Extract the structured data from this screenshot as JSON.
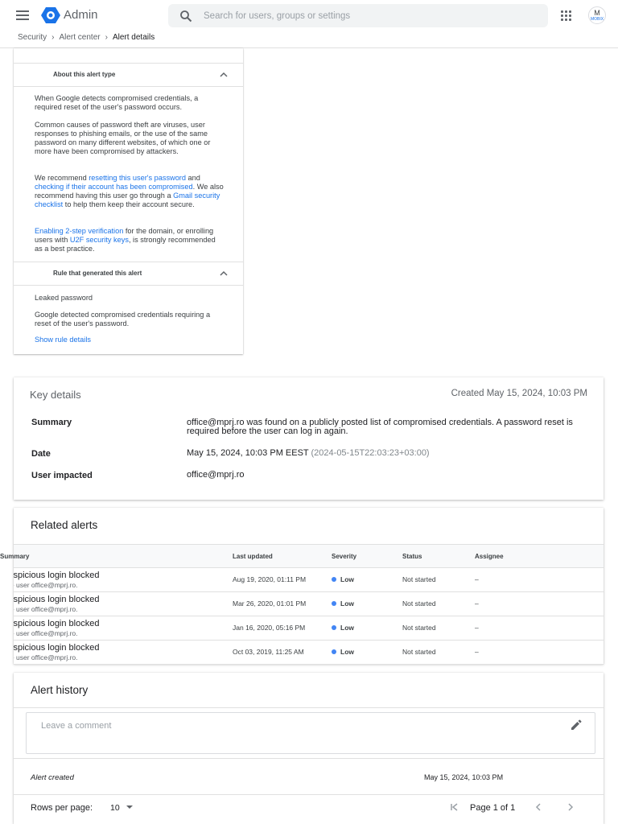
{
  "header": {
    "brand": "Admin",
    "search_placeholder": "Search for users, groups or settings",
    "avatar_text": "M",
    "avatar_small": "MOBIX"
  },
  "breadcrumb": [
    "Security",
    "Alert center",
    "Alert details"
  ],
  "about_panel": {
    "title": "About this alert type",
    "p1": "When Google detects compromised credentials, a required reset of the user's password occurs.",
    "p2": "Common causes of password theft are viruses, user responses to phishing emails, or the use of the same password on many different websites, of which one or more have been compromised by attackers.",
    "p3_a": "We recommend ",
    "p3_link1": "resetting this user's password",
    "p3_b": " and ",
    "p3_link2": "checking if their account has been compromised",
    "p3_c": ". We also recommend having this user go through a ",
    "p3_link3": "Gmail security checklist",
    "p3_d": " to help them keep their account secure.",
    "p4_link1": "Enabling 2-step verification",
    "p4_a": " for the domain, or enrolling users with ",
    "p4_link2": "U2F security keys",
    "p4_b": ", is strongly recommended as a best practice."
  },
  "rule_panel": {
    "title": "Rule that generated this alert",
    "rule_name": "Leaked password",
    "description": "Google detected compromised credentials requiring a reset of the user's password.",
    "link": "Show rule details"
  },
  "key_details": {
    "title": "Key details",
    "created": "Created May 15, 2024, 10:03 PM",
    "summary_label": "Summary",
    "summary_value": "office@mprj.ro was found on a publicly posted list of compromised credentials. A password reset is required before the user can log in again.",
    "date_label": "Date",
    "date_value": "May 15, 2024, 10:03 PM EEST",
    "date_iso": "(2024-05-15T22:03:23+03:00)",
    "user_label": "User impacted",
    "user_value": "office@mprj.ro"
  },
  "related_alerts": {
    "title": "Related alerts",
    "columns": [
      "Summary",
      "Last updated",
      "Severity",
      "Status",
      "Assignee"
    ],
    "rows": [
      {
        "summary": "Suspicious login blocked",
        "sub": "The user office@mprj.ro.",
        "updated": "Aug 19, 2020, 01:11 PM",
        "severity": "Low",
        "status": "Not started",
        "assignee": "–"
      },
      {
        "summary": "Suspicious login blocked",
        "sub": "The user office@mprj.ro.",
        "updated": "Mar 26, 2020, 01:01 PM",
        "severity": "Low",
        "status": "Not started",
        "assignee": "–"
      },
      {
        "summary": "Suspicious login blocked",
        "sub": "The user office@mprj.ro.",
        "updated": "Jan 16, 2020, 05:16 PM",
        "severity": "Low",
        "status": "Not started",
        "assignee": "–"
      },
      {
        "summary": "Suspicious login blocked",
        "sub": "The user office@mprj.ro.",
        "updated": "Oct 03, 2019, 11:25 AM",
        "severity": "Low",
        "status": "Not started",
        "assignee": "–"
      }
    ],
    "severity_color": "#4285f4"
  },
  "alert_history": {
    "title": "Alert history",
    "comment_placeholder": "Leave a comment",
    "event": "Alert created",
    "event_time": "May 15, 2024, 10:03 PM",
    "rows_per_page_label": "Rows per page:",
    "rows_per_page_value": "10",
    "page_text": "Page 1 of 1"
  },
  "colors": {
    "accent": "#1a73e8",
    "logo_blue": "#1a73e8"
  }
}
